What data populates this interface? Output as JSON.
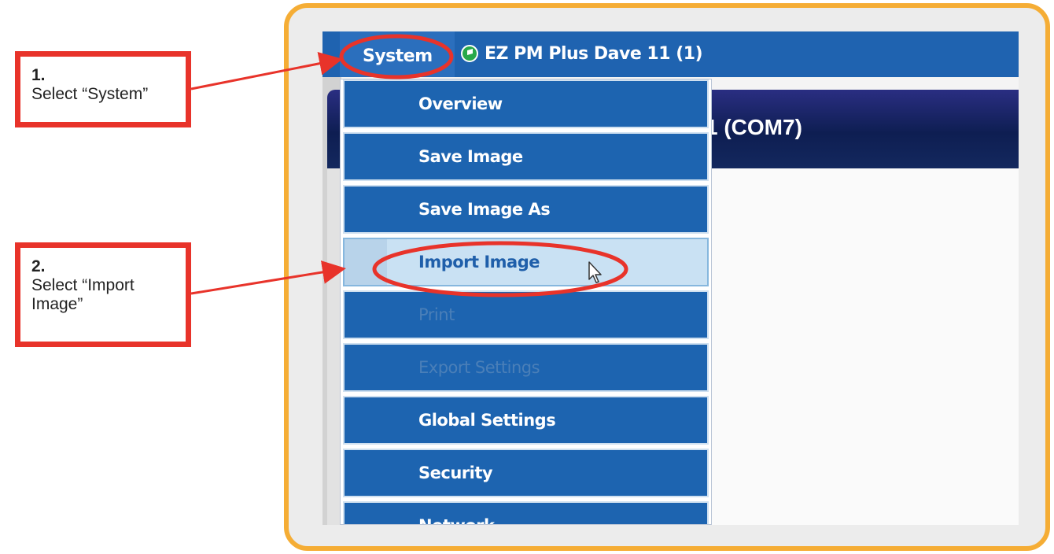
{
  "callouts": [
    {
      "number": "1.",
      "text": "Select “System”"
    },
    {
      "number": "2.",
      "text": "Select “Import Image”"
    }
  ],
  "app": {
    "menu_system": "System",
    "device_tab": "EZ PM Plus Dave 11 (1)",
    "title_partial": "1 (COM7)"
  },
  "dropdown": {
    "items": [
      {
        "label": "Overview",
        "state": "enabled"
      },
      {
        "label": "Save Image",
        "state": "enabled"
      },
      {
        "label": "Save Image As",
        "state": "enabled"
      },
      {
        "label": "Import Image",
        "state": "hovered"
      },
      {
        "label": "Print",
        "state": "disabled"
      },
      {
        "label": "Export Settings",
        "state": "disabled"
      },
      {
        "label": "Global Settings",
        "state": "enabled"
      },
      {
        "label": "Security",
        "state": "enabled"
      },
      {
        "label": "Network",
        "state": "enabled"
      }
    ]
  },
  "colors": {
    "frame": "#f5ad35",
    "highlight": "#e8332a",
    "menu_blue": "#1d64b0",
    "hover": "#c9e1f3",
    "status_dot": "#27a94a"
  },
  "icons": [
    "flag-status-icon",
    "mouse-cursor-icon"
  ]
}
